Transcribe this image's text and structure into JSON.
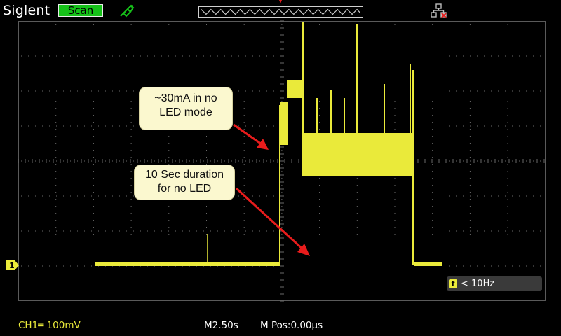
{
  "header": {
    "brand": "Siglent",
    "mode": "Scan",
    "probe_icon": "probe-icon",
    "network_icon": "network-disconnected-icon"
  },
  "annotations": {
    "current_note": {
      "line1": "~30mA in no",
      "line2": "LED mode"
    },
    "duration_note": {
      "line1": "10 Sec duration",
      "line2": "for no LED"
    }
  },
  "measurement": {
    "freq_icon_label": "f",
    "freq": "< 10Hz"
  },
  "status": {
    "ch1_scale": "CH1═ 100mV",
    "timebase": "M2.50s",
    "mpos": "M Pos:0.00µs"
  },
  "channel_marker": "1",
  "colors": {
    "trace": "#eaea3a",
    "mode_badge": "#16c219",
    "callout_bg": "#fbf8cf",
    "arrow": "#e81c1c",
    "grid": "#5a5a5a"
  }
}
